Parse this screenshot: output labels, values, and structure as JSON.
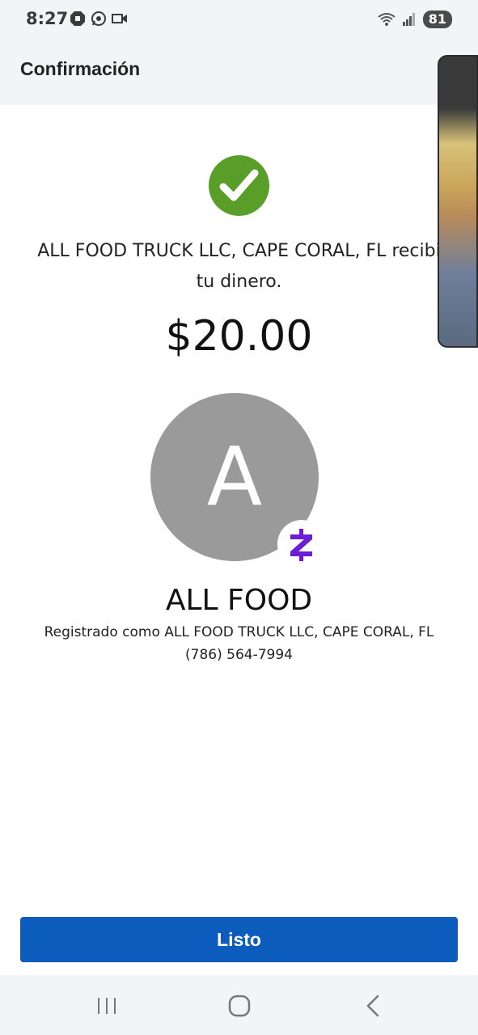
{
  "status_bar": {
    "time": "8:27",
    "battery": "81",
    "left_icons": [
      "chase-icon",
      "whatsapp-icon",
      "video-call-icon"
    ],
    "right_icons": [
      "wifi-icon",
      "signal-icon",
      "battery-icon"
    ]
  },
  "header": {
    "title": "Confirmación"
  },
  "confirmation": {
    "message_line1": "ALL FOOD TRUCK LLC, CAPE CORAL, FL recibi",
    "message_line2": "tu dinero.",
    "amount": "$20.00",
    "avatar_letter": "A",
    "merchant_name": "ALL FOOD",
    "registered_as": "Registrado como ALL FOOD TRUCK LLC, CAPE CORAL, FL",
    "phone": "(786) 564-7994"
  },
  "actions": {
    "done_label": "Listo"
  },
  "colors": {
    "accent": "#0b5cbc",
    "success": "#5a9e2a",
    "zelle": "#6d1ed4",
    "avatar_bg": "#9a9a9a"
  },
  "nav": {
    "buttons": [
      "recents-icon",
      "home-icon",
      "back-icon"
    ]
  }
}
